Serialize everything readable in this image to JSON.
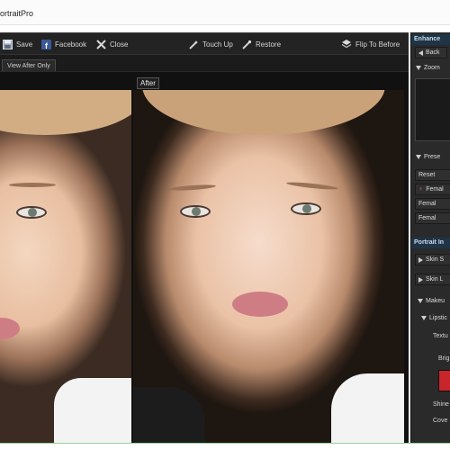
{
  "window": {
    "title": "ortraitPro"
  },
  "toolbar": {
    "save": "Save",
    "facebook": "Facebook",
    "close": "Close",
    "touch_up": "Touch Up",
    "restore": "Restore",
    "flip": "Flip To Before"
  },
  "view": {
    "tab": "View After Only",
    "after_label": "After"
  },
  "panel": {
    "enhance_header": "Enhance",
    "back": "Back",
    "zoom": "Zoom",
    "presets": "Prese",
    "reset": "Reset",
    "female_1": "Femal",
    "female_2": "Femal",
    "female_3": "Femal",
    "portrait_header": "Portrait In",
    "skin_1": "Skin S",
    "skin_2": "Skin L",
    "makeup": "Makeu",
    "lipstick": "Lipstic",
    "texture": "Textu",
    "brightness": "Brig",
    "shine": "Shine",
    "cover": "Cove",
    "lip_color": "#c8262b"
  },
  "icons": [
    "save-icon",
    "facebook-icon",
    "close-icon",
    "touch-up-icon",
    "restore-icon",
    "flip-icon",
    "back-icon",
    "pin-icon"
  ]
}
